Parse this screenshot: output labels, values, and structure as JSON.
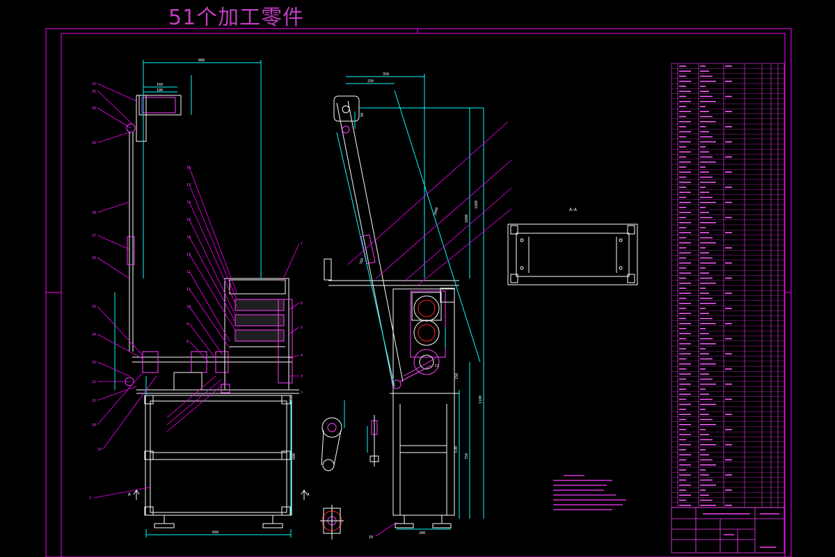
{
  "page": {
    "heading": "51个加工零件"
  },
  "colors": {
    "background": "#000000",
    "frame": "#ff00ff",
    "parts": "#ffffff",
    "dimension": "#00ffff",
    "leader": "#ff00ff",
    "table_text": "#ff40ff",
    "part_accent": "#ff2020",
    "notes": "#ff40ff"
  },
  "views": {
    "section_label": "A—A",
    "section_marker_left": "A",
    "section_marker_right": "A"
  }
}
